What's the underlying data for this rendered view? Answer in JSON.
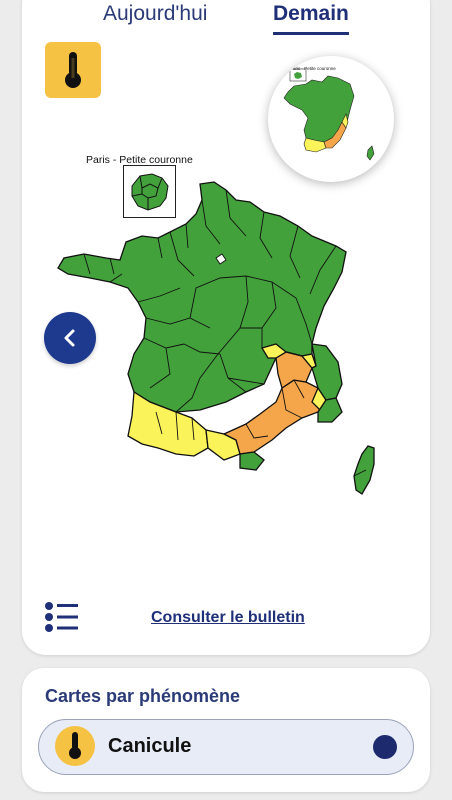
{
  "tabs": {
    "today": "Aujourd'hui",
    "tomorrow": "Demain",
    "active": "tomorrow"
  },
  "map": {
    "paris_inset_label": "Paris - Petite couronne",
    "mini_map_label": "Paris - Petite couronne",
    "legend_colors": {
      "green": "#43a13b",
      "yellow": "#fbf35a",
      "orange": "#f5a64b"
    },
    "icons": {
      "phenomenon": "thermometer-icon",
      "previous": "chevron-left-icon",
      "list": "list-icon"
    }
  },
  "footer": {
    "bulletin_link": "Consulter le bulletin"
  },
  "phenomenon_cards": {
    "title": "Cartes par phénomène",
    "selected": "Canicule",
    "accent": "#f6c244",
    "selected_dot_color": "#1e2a6e"
  }
}
